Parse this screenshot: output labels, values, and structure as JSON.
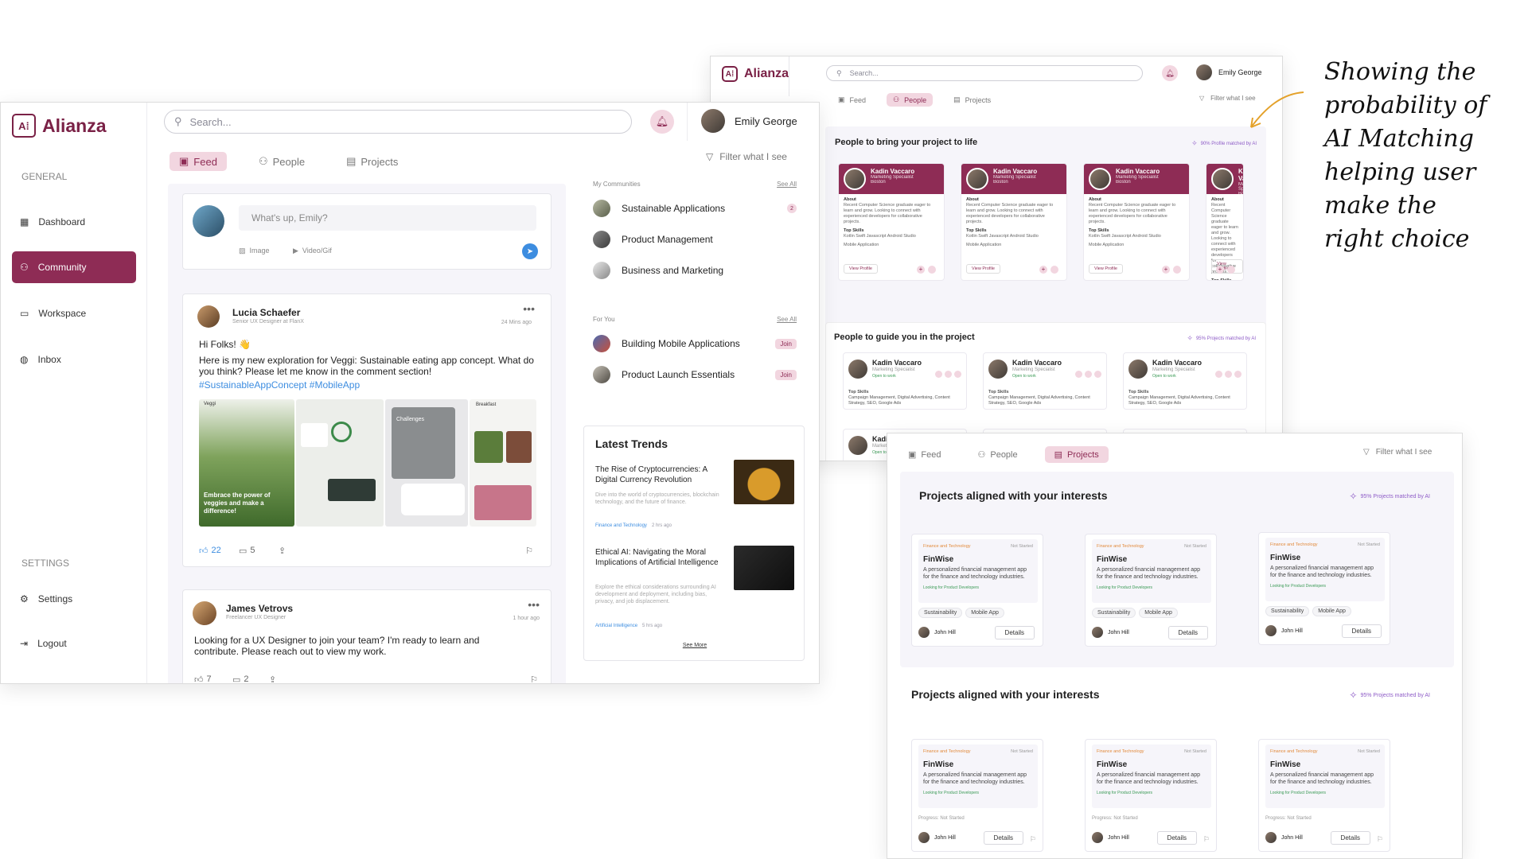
{
  "brand": "Alianza",
  "search_placeholder": "Search...",
  "user": "Emily George",
  "tabs": {
    "feed": "Feed",
    "people": "People",
    "projects": "Projects"
  },
  "filter": "Filter what I see",
  "main": {
    "sidebar": {
      "general": "GENERAL",
      "settings_heading": "SETTINGS",
      "items": [
        "Dashboard",
        "Community",
        "Workspace",
        "Inbox"
      ],
      "settings": "Settings",
      "logout": "Logout"
    },
    "composer": {
      "placeholder": "What's up, Emily?",
      "image": "Image",
      "video": "Video/Gif"
    },
    "posts": [
      {
        "author": "Lucia Schaefer",
        "role": "Senior UX Designer at FlanX",
        "time": "24 Mins ago",
        "greeting": "Hi Folks! 👋",
        "text": "Here is my new exploration for Veggi:  Sustainable eating app concept. What do you think? Please let me know in the comment section!",
        "tags": "#SustainableAppConcept #MobileApp",
        "likes": "22",
        "comments": "5",
        "img_caption": "Embrace the power of veggies and make a difference!",
        "img_challenges": "Challenges",
        "img_breakfast": "Breakfast",
        "img_veggi": "Veggi"
      },
      {
        "author": "James Vetrovs",
        "role": "Freelancer UX Designer",
        "time": "1 hour ago",
        "text": "Looking for a UX Designer to join your team? I'm ready to learn and contribute. Please reach out to view my work.",
        "likes": "7",
        "comments": "2"
      }
    ],
    "my_communities": {
      "heading": "My Communities",
      "see_all": "See All",
      "items": [
        {
          "name": "Sustainable Applications",
          "badge": "2"
        },
        {
          "name": "Product Management"
        },
        {
          "name": "Business and Marketing"
        }
      ]
    },
    "for_you": {
      "heading": "For You",
      "see_all": "See All",
      "items": [
        {
          "name": "Building Mobile Applications",
          "action": "Join"
        },
        {
          "name": "Product Launch Essentials",
          "action": "Join"
        }
      ]
    },
    "trends": {
      "heading": "Latest Trends",
      "items": [
        {
          "title": "The Rise of Cryptocurrencies: A Digital Currency Revolution",
          "desc": "Dive into the world of cryptocurrencies, blockchain technology, and the future of finance.",
          "tag": "Finance and Technology",
          "time": "2 hrs ago"
        },
        {
          "title": "Ethical AI: Navigating the Moral Implications of Artificial Intelligence",
          "desc": "Explore the ethical considerations surrounding AI development and deployment, including bias, privacy, and job displacement.",
          "tag": "Artificial Intelligence",
          "time": "5 hrs ago"
        }
      ],
      "see_more": "See More"
    }
  },
  "people_win": {
    "section1": "People to bring your project to life",
    "match1": "90% Profile matched by AI",
    "section2": "People to guide you in the project",
    "match2": "95% Projects matched by AI",
    "profile": {
      "name": "Kadin Vaccaro",
      "role": "Marketing Specialist",
      "location": "Boston",
      "about_label": "About",
      "about": "Recent Computer Science graduate eager to learn and grow. Looking to connect with experienced developers for collaborative projects.",
      "skills_label": "Top Skills",
      "skills": "Kotlin   Swift   Javascript   Android Studio",
      "skill2": "Mobile Application",
      "view": "View Profile"
    },
    "guide": {
      "name": "Kadin Vaccaro",
      "role": "Marketing Specialist",
      "status": "Open to work",
      "skills_label": "Top Skills",
      "skills": "Campaign Management, Digital Advertising, Content Strategy, SEO, Google Ads"
    }
  },
  "projects_win": {
    "section": "Projects aligned with your interests",
    "match": "95% Projects matched by AI",
    "project": {
      "category": "Finance and Technology",
      "status": "Not Started",
      "title": "FinWise",
      "desc": "A personalized financial management app for the finance and technology industries.",
      "looking": "Looking for Product Developers",
      "tags": [
        "Sustainability",
        "Mobile App"
      ],
      "owner": "John Hill",
      "details": "Details",
      "progress": "Progress: Not Started"
    }
  },
  "annotation": [
    "Showing the",
    "probability of",
    "AI Matching",
    "helping user",
    "make the",
    "right choice"
  ],
  "colors": {
    "accent": "#8e2c55",
    "accent_light": "#f2d6e0",
    "panel": "#f6f5fa"
  }
}
